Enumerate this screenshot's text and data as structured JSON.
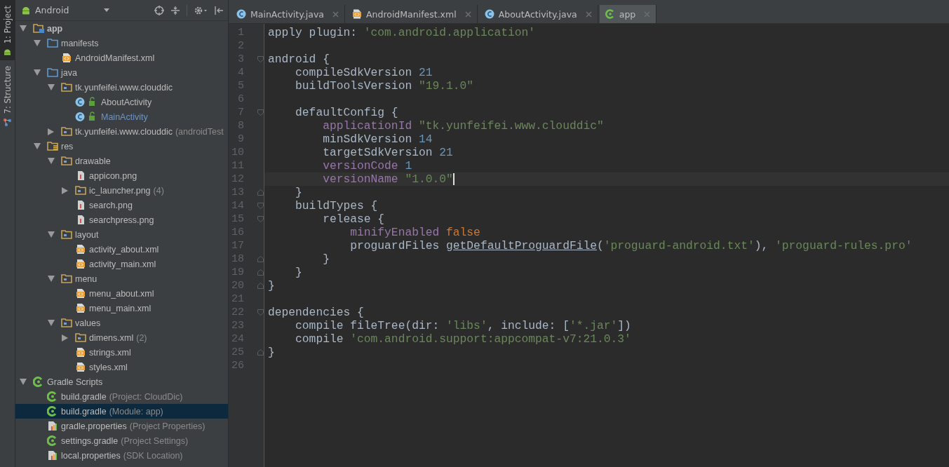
{
  "tool_stripe": [
    {
      "label": "1: Project",
      "kind": "project",
      "selected": true
    },
    {
      "label": "7: Structure",
      "kind": "structure",
      "selected": false
    }
  ],
  "project_panel": {
    "view": "Android",
    "tree": [
      {
        "label": "app",
        "kind": "module",
        "expanded": true,
        "selected": false,
        "children": [
          {
            "label": "manifests",
            "kind": "src-folder",
            "expanded": true,
            "selected": false,
            "children": [
              {
                "label": "AndroidManifest.xml",
                "kind": "xml",
                "selected": false
              }
            ]
          },
          {
            "label": "java",
            "kind": "src-folder",
            "expanded": true,
            "selected": false,
            "children": [
              {
                "label": "tk.yunfeifei.www.clouddic",
                "kind": "package",
                "expanded": true,
                "selected": false,
                "children": [
                  {
                    "label": "AboutActivity",
                    "kind": "class",
                    "selected": false
                  },
                  {
                    "label": "MainActivity",
                    "kind": "class",
                    "selected": false,
                    "color": "#6e94c4"
                  }
                ]
              },
              {
                "label": "tk.yunfeifei.www.clouddic",
                "suffix": "(androidTest",
                "kind": "package",
                "expanded": false,
                "selected": false
              }
            ]
          },
          {
            "label": "res",
            "kind": "res-folder",
            "expanded": true,
            "selected": false,
            "children": [
              {
                "label": "drawable",
                "kind": "package",
                "expanded": true,
                "selected": false,
                "children": [
                  {
                    "label": "appicon.png",
                    "kind": "image",
                    "selected": false
                  },
                  {
                    "label": "ic_launcher.png",
                    "suffix": "(4)",
                    "kind": "package",
                    "expanded": false,
                    "selected": false
                  },
                  {
                    "label": "search.png",
                    "kind": "image",
                    "selected": false
                  },
                  {
                    "label": "searchpress.png",
                    "kind": "image",
                    "selected": false
                  }
                ]
              },
              {
                "label": "layout",
                "kind": "package",
                "expanded": true,
                "selected": false,
                "children": [
                  {
                    "label": "activity_about.xml",
                    "kind": "xml",
                    "selected": false
                  },
                  {
                    "label": "activity_main.xml",
                    "kind": "xml",
                    "selected": false
                  }
                ]
              },
              {
                "label": "menu",
                "kind": "package",
                "expanded": true,
                "selected": false,
                "children": [
                  {
                    "label": "menu_about.xml",
                    "kind": "xml",
                    "selected": false
                  },
                  {
                    "label": "menu_main.xml",
                    "kind": "xml",
                    "selected": false
                  }
                ]
              },
              {
                "label": "values",
                "kind": "package",
                "expanded": true,
                "selected": false,
                "children": [
                  {
                    "label": "dimens.xml",
                    "suffix": "(2)",
                    "kind": "package",
                    "expanded": false,
                    "selected": false
                  },
                  {
                    "label": "strings.xml",
                    "kind": "xml",
                    "selected": false
                  },
                  {
                    "label": "styles.xml",
                    "kind": "xml",
                    "selected": false
                  }
                ]
              }
            ]
          }
        ]
      },
      {
        "label": "Gradle Scripts",
        "kind": "gradle",
        "expanded": true,
        "selected": false,
        "children": [
          {
            "label": "build.gradle",
            "suffix": "(Project: CloudDic)",
            "kind": "gradle",
            "selected": false
          },
          {
            "label": "build.gradle",
            "suffix": "(Module: app)",
            "kind": "gradle",
            "selected": true
          },
          {
            "label": "gradle.properties",
            "suffix": "(Project Properties)",
            "kind": "properties",
            "selected": false
          },
          {
            "label": "settings.gradle",
            "suffix": "(Project Settings)",
            "kind": "gradle",
            "selected": false
          },
          {
            "label": "local.properties",
            "suffix": "(SDK Location)",
            "kind": "properties",
            "selected": false
          }
        ]
      }
    ]
  },
  "editor_tabs": [
    {
      "label": "MainActivity.java",
      "kind": "class",
      "selected": false
    },
    {
      "label": "AndroidManifest.xml",
      "kind": "xml",
      "selected": false
    },
    {
      "label": "AboutActivity.java",
      "kind": "class",
      "selected": false
    },
    {
      "label": "app",
      "kind": "gradle",
      "selected": true
    }
  ],
  "code_lines": [
    {
      "number": "1",
      "kind": "plain",
      "current": false,
      "tokens": [
        {
          "kind": "plain",
          "text": "apply plugin: "
        },
        {
          "kind": "string",
          "text": "'com.android.application'"
        }
      ]
    },
    {
      "number": "2",
      "kind": "plain",
      "current": false
    },
    {
      "number": "3",
      "kind": "open",
      "current": false,
      "tokens": [
        {
          "kind": "plain",
          "text": "android {"
        }
      ]
    },
    {
      "number": "4",
      "kind": "plain",
      "current": false,
      "tokens": [
        {
          "kind": "plain",
          "text": "    compileSdkVersion "
        },
        {
          "kind": "number",
          "text": "21"
        }
      ]
    },
    {
      "number": "5",
      "kind": "plain",
      "current": false,
      "tokens": [
        {
          "kind": "plain",
          "text": "    buildToolsVersion "
        },
        {
          "kind": "string",
          "text": "\"19.1.0\""
        }
      ]
    },
    {
      "number": "6",
      "kind": "plain",
      "current": false
    },
    {
      "number": "7",
      "kind": "open",
      "current": false,
      "tokens": [
        {
          "kind": "plain",
          "text": "    defaultConfig {"
        }
      ]
    },
    {
      "number": "8",
      "kind": "plain",
      "current": false,
      "tokens": [
        {
          "kind": "field",
          "text": "        applicationId "
        },
        {
          "kind": "string",
          "text": "\"tk.yunfeifei.www.clouddic\""
        }
      ]
    },
    {
      "number": "9",
      "kind": "plain",
      "current": false,
      "tokens": [
        {
          "kind": "plain",
          "text": "        minSdkVersion "
        },
        {
          "kind": "number",
          "text": "14"
        }
      ]
    },
    {
      "number": "10",
      "kind": "plain",
      "current": false,
      "tokens": [
        {
          "kind": "plain",
          "text": "        targetSdkVersion "
        },
        {
          "kind": "number",
          "text": "21"
        }
      ]
    },
    {
      "number": "11",
      "kind": "plain",
      "current": false,
      "tokens": [
        {
          "kind": "field",
          "text": "        versionCode "
        },
        {
          "kind": "number",
          "text": "1"
        }
      ]
    },
    {
      "number": "12",
      "kind": "plain",
      "current": true,
      "tokens": [
        {
          "kind": "field",
          "text": "        versionName "
        },
        {
          "kind": "string",
          "text": "\"1.0.0\""
        }
      ]
    },
    {
      "number": "13",
      "kind": "close",
      "current": false,
      "tokens": [
        {
          "kind": "plain",
          "text": "    }"
        }
      ]
    },
    {
      "number": "14",
      "kind": "open",
      "current": false,
      "tokens": [
        {
          "kind": "plain",
          "text": "    buildTypes {"
        }
      ]
    },
    {
      "number": "15",
      "kind": "open",
      "current": false,
      "tokens": [
        {
          "kind": "plain",
          "text": "        release {"
        }
      ]
    },
    {
      "number": "16",
      "kind": "plain",
      "current": false,
      "tokens": [
        {
          "kind": "field",
          "text": "            minifyEnabled "
        },
        {
          "kind": "keyword",
          "text": "false"
        }
      ]
    },
    {
      "number": "17",
      "kind": "plain",
      "current": false,
      "tokens": [
        {
          "kind": "plain",
          "text": "            proguardFiles "
        },
        {
          "kind": "call",
          "text": "getDefaultProguardFile"
        },
        {
          "kind": "plain",
          "text": "("
        },
        {
          "kind": "string",
          "text": "'proguard-android.txt'"
        },
        {
          "kind": "plain",
          "text": "), "
        },
        {
          "kind": "string",
          "text": "'proguard-rules.pro'"
        }
      ]
    },
    {
      "number": "18",
      "kind": "close",
      "current": false,
      "tokens": [
        {
          "kind": "plain",
          "text": "        }"
        }
      ]
    },
    {
      "number": "19",
      "kind": "close",
      "current": false,
      "tokens": [
        {
          "kind": "plain",
          "text": "    }"
        }
      ]
    },
    {
      "number": "20",
      "kind": "close",
      "current": false,
      "tokens": [
        {
          "kind": "plain",
          "text": "}"
        }
      ]
    },
    {
      "number": "21",
      "kind": "plain",
      "current": false
    },
    {
      "number": "22",
      "kind": "open",
      "current": false,
      "tokens": [
        {
          "kind": "plain",
          "text": "dependencies {"
        }
      ]
    },
    {
      "number": "23",
      "kind": "plain",
      "current": false,
      "tokens": [
        {
          "kind": "plain",
          "text": "    compile fileTree(dir: "
        },
        {
          "kind": "string",
          "text": "'libs'"
        },
        {
          "kind": "plain",
          "text": ", include: ["
        },
        {
          "kind": "string",
          "text": "'*.jar'"
        },
        {
          "kind": "plain",
          "text": "])"
        }
      ]
    },
    {
      "number": "24",
      "kind": "plain",
      "current": false,
      "tokens": [
        {
          "kind": "plain",
          "text": "    compile "
        },
        {
          "kind": "string",
          "text": "'com.android.support:appcompat-v7:21.0.3'"
        }
      ]
    },
    {
      "number": "25",
      "kind": "close",
      "current": false,
      "tokens": [
        {
          "kind": "plain",
          "text": "}"
        }
      ]
    },
    {
      "number": "26",
      "kind": "plain",
      "current": false
    }
  ]
}
